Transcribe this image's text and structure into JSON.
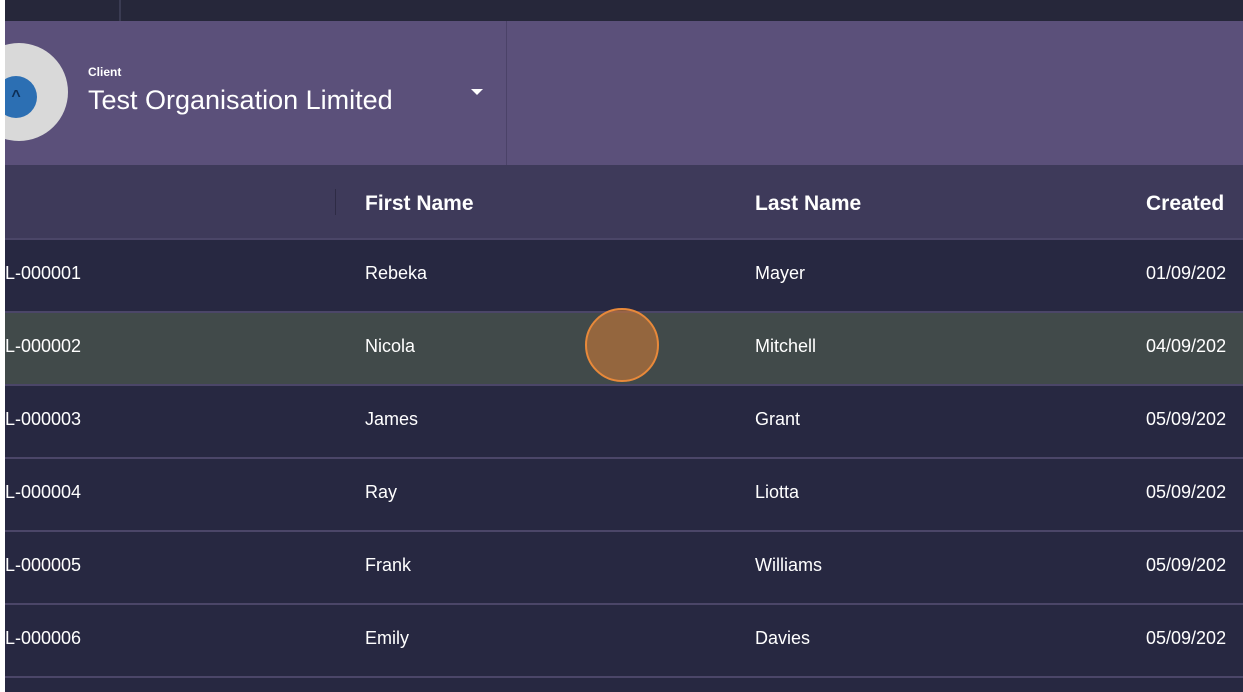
{
  "header": {
    "client_label": "Client",
    "client_name": "Test Organisation Limited",
    "logo_icon": "organisation-logo-icon",
    "dropdown_icon": "chevron-down-icon"
  },
  "table": {
    "columns": [
      "",
      "First Name",
      "Last Name",
      "Created"
    ],
    "rows": [
      {
        "id": "L-000001",
        "first": "Rebeka",
        "last": "Mayer",
        "created": "01/09/202"
      },
      {
        "id": "L-000002",
        "first": "Nicola",
        "last": "Mitchell",
        "created": "04/09/202"
      },
      {
        "id": "L-000003",
        "first": "James",
        "last": "Grant",
        "created": "05/09/202"
      },
      {
        "id": "L-000004",
        "first": "Ray",
        "last": "Liotta",
        "created": "05/09/202"
      },
      {
        "id": "L-000005",
        "first": "Frank",
        "last": "Williams",
        "created": "05/09/202"
      },
      {
        "id": "L-000006",
        "first": "Emily",
        "last": "Davies",
        "created": "05/09/202"
      }
    ]
  },
  "colors": {
    "header_bg": "#5b507a",
    "table_header_bg": "#3e3a5a",
    "row_bg": "#272841",
    "row_highlight_bg": "#414a4a",
    "click_indicator": "#e8893a"
  }
}
